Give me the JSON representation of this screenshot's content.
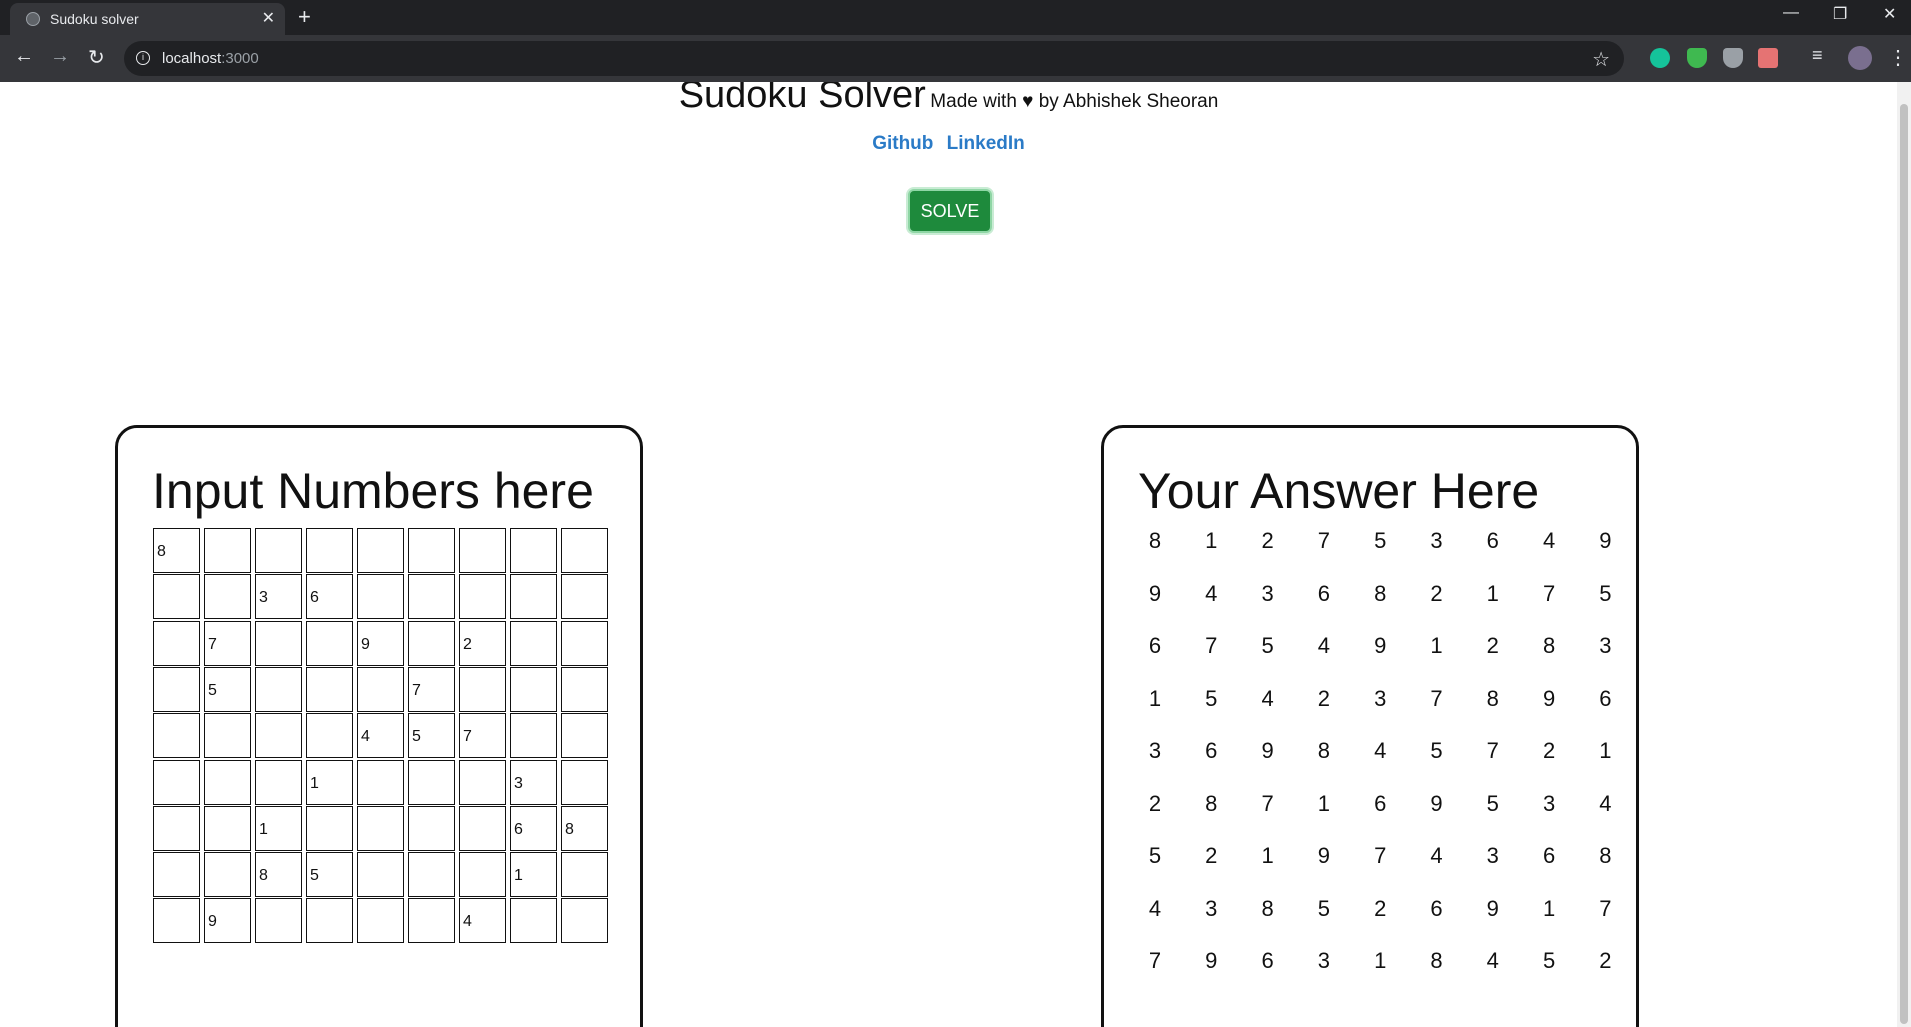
{
  "browser": {
    "tab_title": "Sudoku solver",
    "tab_close": "✕",
    "new_tab": "+",
    "url_host": "localhost",
    "url_port": ":3000"
  },
  "header": {
    "title": "Sudoku Solver",
    "subtitle": "Made with ♥ by Abhishek Sheoran",
    "links": [
      "Github",
      "LinkedIn"
    ],
    "solve_label": "SOLVE"
  },
  "input_card": {
    "title": "Input Numbers here",
    "grid": [
      [
        "8",
        "",
        "",
        "",
        "",
        "",
        "",
        "",
        ""
      ],
      [
        "",
        "",
        "3",
        "6",
        "",
        "",
        "",
        "",
        ""
      ],
      [
        "",
        "7",
        "",
        "",
        "9",
        "",
        "2",
        "",
        ""
      ],
      [
        "",
        "5",
        "",
        "",
        "",
        "7",
        "",
        "",
        ""
      ],
      [
        "",
        "",
        "",
        "",
        "4",
        "5",
        "7",
        "",
        ""
      ],
      [
        "",
        "",
        "",
        "1",
        "",
        "",
        "",
        "3",
        ""
      ],
      [
        "",
        "",
        "1",
        "",
        "",
        "",
        "",
        "6",
        "8"
      ],
      [
        "",
        "",
        "8",
        "5",
        "",
        "",
        "",
        "1",
        ""
      ],
      [
        "",
        "9",
        "",
        "",
        "",
        "",
        "4",
        "",
        ""
      ]
    ]
  },
  "answer_card": {
    "title": "Your Answer Here",
    "grid": [
      [
        "8",
        "1",
        "2",
        "7",
        "5",
        "3",
        "6",
        "4",
        "9"
      ],
      [
        "9",
        "4",
        "3",
        "6",
        "8",
        "2",
        "1",
        "7",
        "5"
      ],
      [
        "6",
        "7",
        "5",
        "4",
        "9",
        "1",
        "2",
        "8",
        "3"
      ],
      [
        "1",
        "5",
        "4",
        "2",
        "3",
        "7",
        "8",
        "9",
        "6"
      ],
      [
        "3",
        "6",
        "9",
        "8",
        "4",
        "5",
        "7",
        "2",
        "1"
      ],
      [
        "2",
        "8",
        "7",
        "1",
        "6",
        "9",
        "5",
        "3",
        "4"
      ],
      [
        "5",
        "2",
        "1",
        "9",
        "7",
        "4",
        "3",
        "6",
        "8"
      ],
      [
        "4",
        "3",
        "8",
        "5",
        "2",
        "6",
        "9",
        "1",
        "7"
      ],
      [
        "7",
        "9",
        "6",
        "3",
        "1",
        "8",
        "4",
        "5",
        "2"
      ]
    ]
  }
}
